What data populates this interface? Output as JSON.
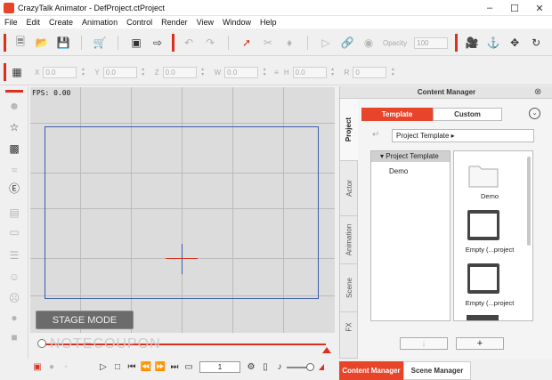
{
  "window": {
    "title": "CrazyTalk Animator - DefProject.ctProject"
  },
  "menu": [
    "File",
    "Edit",
    "Create",
    "Animation",
    "Control",
    "Render",
    "View",
    "Window",
    "Help"
  ],
  "toolbar1": {
    "opacity_label": "Opacity",
    "opacity_value": "100"
  },
  "toolbar2": {
    "fields": [
      {
        "label": "X",
        "value": "0.0"
      },
      {
        "label": "Y",
        "value": "0.0"
      },
      {
        "label": "Z",
        "value": "0.0"
      },
      {
        "label": "W",
        "value": "0.0"
      },
      {
        "label": "H",
        "value": "0.0"
      },
      {
        "label": "R",
        "value": "0"
      }
    ]
  },
  "stage": {
    "fps": "FPS: 0.00",
    "mode_label": "STAGE MODE"
  },
  "playback": {
    "frame": "1"
  },
  "content_manager": {
    "title": "Content Manager",
    "vertical_tabs": [
      "Project",
      "Actor",
      "Animation",
      "Scene",
      "FX"
    ],
    "tabs": [
      "Template",
      "Custom"
    ],
    "breadcrumb": "Project Template",
    "tree": {
      "header": "Project Template",
      "items": [
        "Demo"
      ]
    },
    "thumbnails": [
      "Demo",
      "Empty (...project",
      "Empty (...project"
    ]
  },
  "bottom_tabs": [
    "Content Manager",
    "Scene Manager"
  ],
  "watermark": "NOTECOUPON",
  "colors": {
    "accent": "#e8442a",
    "stage": "#dcdcdc",
    "camera_frame": "#3a5ca8"
  }
}
